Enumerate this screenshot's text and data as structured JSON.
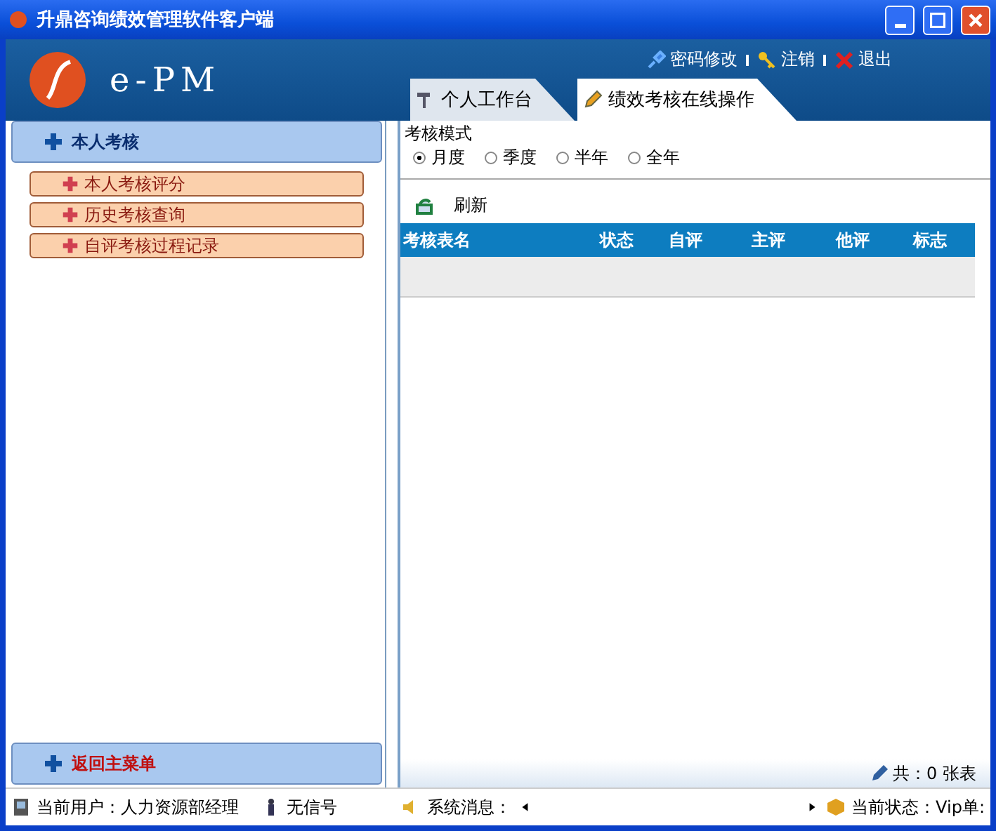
{
  "window": {
    "title": "升鼎咨询绩效管理软件客户端"
  },
  "header": {
    "logo_text": "e-PM",
    "links": [
      {
        "kind": "key-edit",
        "label": "密码修改"
      },
      {
        "kind": "logout",
        "label": "注销"
      },
      {
        "kind": "exit",
        "label": "退出"
      }
    ]
  },
  "tabs": [
    {
      "label": "个人工作台",
      "selected": false,
      "kind": "tools"
    },
    {
      "label": "绩效考核在线操作",
      "selected": true,
      "kind": "pencil"
    }
  ],
  "sidebar": {
    "group": "本人考核",
    "items": [
      "本人考核评分",
      "历史考核查询",
      "自评考核过程记录"
    ],
    "back": "返回主菜单"
  },
  "mode": {
    "legend": "考核模式",
    "options": [
      {
        "label": "月度",
        "selected": true
      },
      {
        "label": "季度",
        "selected": false
      },
      {
        "label": "半年",
        "selected": false
      },
      {
        "label": "全年",
        "selected": false
      }
    ]
  },
  "refresh": "刷新",
  "table": {
    "columns": [
      "考核表名",
      "状态",
      "自评",
      "主评",
      "他评",
      "标志"
    ]
  },
  "summary": "共：0 张表",
  "status_bar": {
    "user": "当前用户：人力资源部经理",
    "signal": "无信号",
    "message": "系统消息：",
    "state": "当前状态：Vip单:"
  }
}
